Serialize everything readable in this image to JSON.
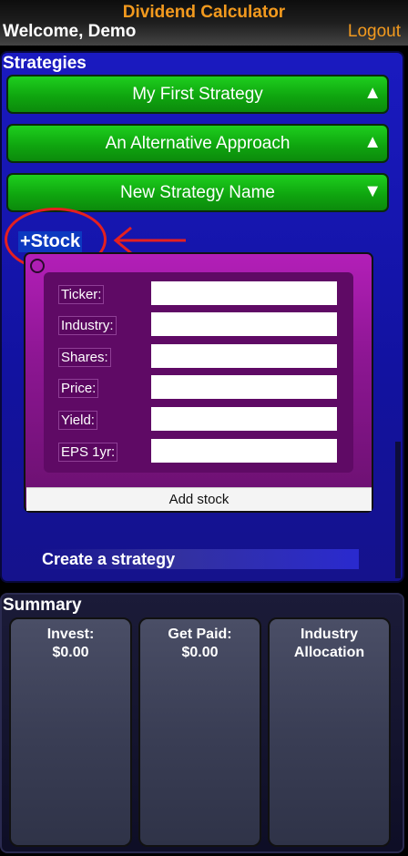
{
  "header": {
    "title": "Dividend Calculator",
    "welcome": "Welcome, Demo",
    "logout": "Logout"
  },
  "strategies": {
    "heading": "Strategies",
    "items": [
      {
        "label": "My First Strategy",
        "arrow": "▲"
      },
      {
        "label": "An Alternative Approach",
        "arrow": "▲"
      },
      {
        "label": "New Strategy Name",
        "arrow": "▼"
      }
    ],
    "add_stock_link": "+Stock",
    "form": {
      "fields": [
        {
          "label": "Ticker:",
          "value": ""
        },
        {
          "label": "Industry:",
          "value": ""
        },
        {
          "label": "Shares:",
          "value": ""
        },
        {
          "label": "Price:",
          "value": ""
        },
        {
          "label": "Yield:",
          "value": ""
        },
        {
          "label": "EPS 1yr:",
          "value": ""
        }
      ],
      "submit_label": "Add stock"
    },
    "create_strategy_label": "Create a strategy"
  },
  "summary": {
    "heading": "Summary",
    "cards": [
      {
        "line1": "Invest:",
        "line2": "$0.00"
      },
      {
        "line1": "Get Paid:",
        "line2": "$0.00"
      },
      {
        "line1": "Industry",
        "line2": "Allocation"
      }
    ]
  },
  "colors": {
    "accent_orange": "#f39a1e",
    "strategy_green": "#12b812",
    "panel_blue": "#1414a8",
    "form_purple": "#8d1693",
    "annotation_red": "#e42020"
  }
}
